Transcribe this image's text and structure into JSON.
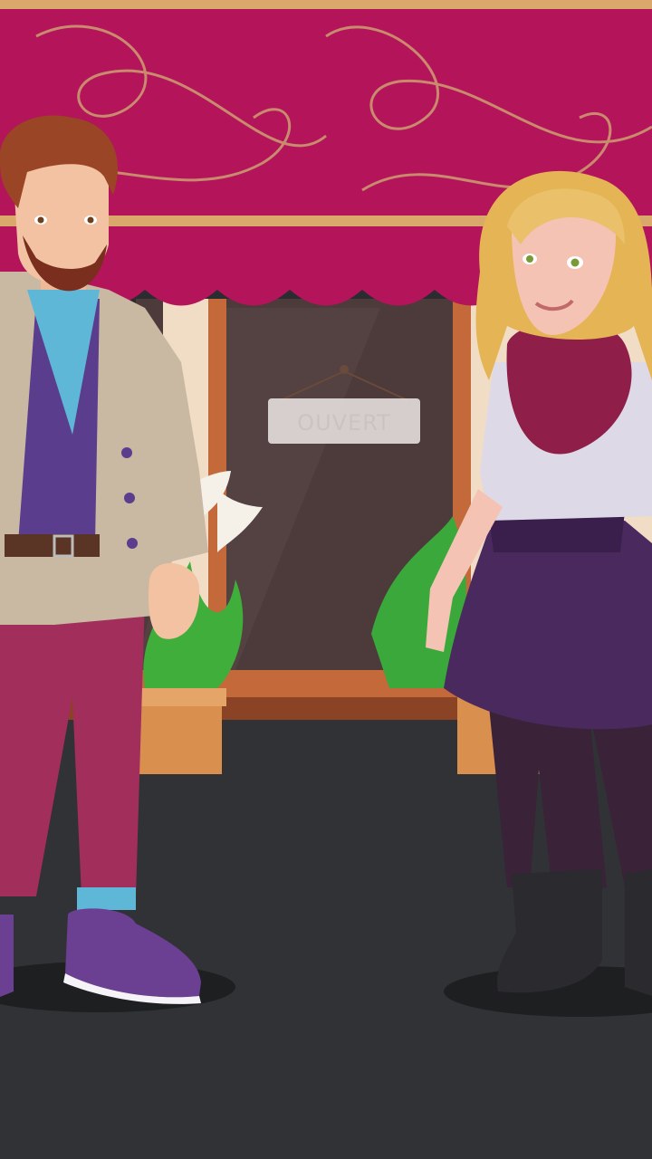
{
  "scene": {
    "sign_text": "OUVERT",
    "colors": {
      "awning": "#b3145a",
      "awning_dark": "#8e0e45",
      "swirl": "#c98a6e",
      "trim": "#d9a86a",
      "ground": "#2a2c2f",
      "window": "#4a3a3a",
      "pillar": "#f1ddc6",
      "frame": "#c46a3a"
    }
  },
  "characters": [
    {
      "id": "man",
      "role": "bearded-man"
    },
    {
      "id": "woman",
      "role": "blonde-woman"
    }
  ]
}
